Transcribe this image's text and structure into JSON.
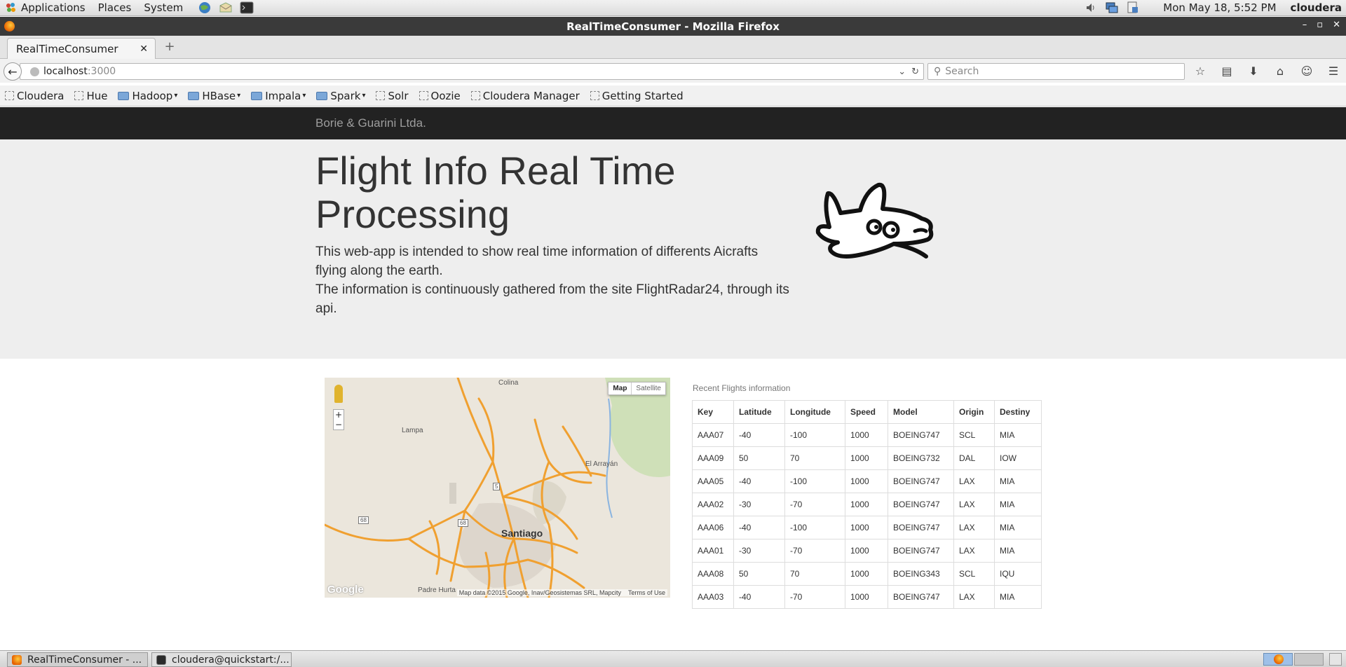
{
  "panel": {
    "menu_applications": "Applications",
    "menu_places": "Places",
    "menu_system": "System",
    "clock": "Mon May 18,  5:52 PM",
    "user": "cloudera"
  },
  "window": {
    "title": "RealTimeConsumer - Mozilla Firefox"
  },
  "browser": {
    "tab_title": "RealTimeConsumer",
    "url_host": "localhost",
    "url_port": ":3000",
    "search_placeholder": "Search"
  },
  "bookmarks": [
    {
      "label": "Cloudera",
      "type": "page"
    },
    {
      "label": "Hue",
      "type": "page"
    },
    {
      "label": "Hadoop",
      "type": "folder"
    },
    {
      "label": "HBase",
      "type": "folder"
    },
    {
      "label": "Impala",
      "type": "folder"
    },
    {
      "label": "Spark",
      "type": "folder"
    },
    {
      "label": "Solr",
      "type": "page"
    },
    {
      "label": "Oozie",
      "type": "page"
    },
    {
      "label": "Cloudera Manager",
      "type": "page"
    },
    {
      "label": "Getting Started",
      "type": "page"
    }
  ],
  "page": {
    "brand": "Borie & Guarini Ltda.",
    "heading": "Flight Info Real Time Processing",
    "intro_1": "This web-app is intended to show real time information of differents Aicrafts flying along the earth.",
    "intro_2": "The information is continuously gathered from the site FlightRadar24, through its api."
  },
  "map": {
    "type_map": "Map",
    "type_satellite": "Satellite",
    "labels": {
      "colina": "Colina",
      "lampa": "Lampa",
      "el_arrayan": "El Arrayán",
      "santiago": "Santiago",
      "padre_hurtado": "Padre Hurta",
      "route_5": "5",
      "route_68a": "68",
      "route_68b": "68"
    },
    "google_logo": "Google",
    "attribution": "Map data ©2015 Google, Inav/Geosistemas SRL, Mapcity",
    "terms": "Terms of Use"
  },
  "flights": {
    "caption": "Recent Flights information",
    "columns": [
      "Key",
      "Latitude",
      "Longitude",
      "Speed",
      "Model",
      "Origin",
      "Destiny"
    ],
    "rows": [
      [
        "AAA07",
        "-40",
        "-100",
        "1000",
        "BOEING747",
        "SCL",
        "MIA"
      ],
      [
        "AAA09",
        "50",
        "70",
        "1000",
        "BOEING732",
        "DAL",
        "IOW"
      ],
      [
        "AAA05",
        "-40",
        "-100",
        "1000",
        "BOEING747",
        "LAX",
        "MIA"
      ],
      [
        "AAA02",
        "-30",
        "-70",
        "1000",
        "BOEING747",
        "LAX",
        "MIA"
      ],
      [
        "AAA06",
        "-40",
        "-100",
        "1000",
        "BOEING747",
        "LAX",
        "MIA"
      ],
      [
        "AAA01",
        "-30",
        "-70",
        "1000",
        "BOEING747",
        "LAX",
        "MIA"
      ],
      [
        "AAA08",
        "50",
        "70",
        "1000",
        "BOEING343",
        "SCL",
        "IQU"
      ],
      [
        "AAA03",
        "-40",
        "-70",
        "1000",
        "BOEING747",
        "LAX",
        "MIA"
      ]
    ]
  },
  "taskbar": {
    "task_1": "RealTimeConsumer - ...",
    "task_2": "cloudera@quickstart:/..."
  },
  "colors": {
    "navbar_dark": "#222222",
    "jumbotron": "#eeeeee",
    "map_roads": "#f0a030"
  }
}
